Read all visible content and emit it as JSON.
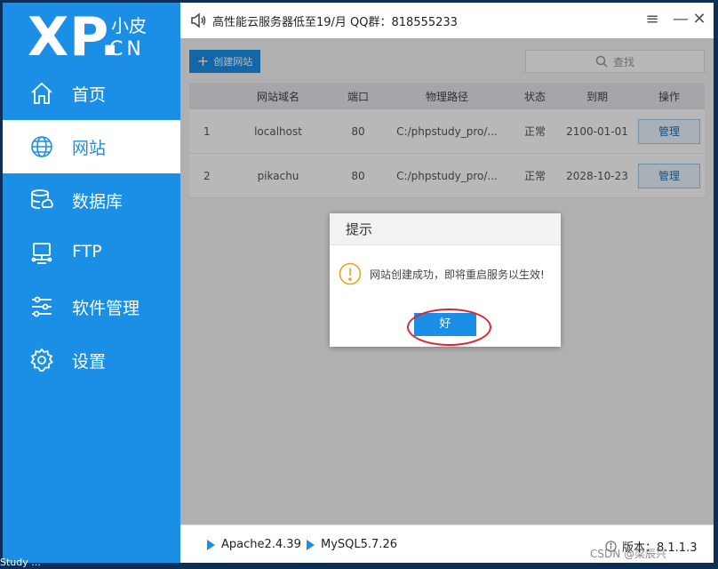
{
  "logo": {
    "main": "XP.",
    "small_top": "小皮",
    "small_bottom": "CN"
  },
  "sidebar": {
    "items": [
      {
        "label": "首页",
        "icon": "home-icon"
      },
      {
        "label": "网站",
        "icon": "globe-icon",
        "active": true
      },
      {
        "label": "数据库",
        "icon": "database-icon"
      },
      {
        "label": "FTP",
        "icon": "ftp-icon"
      },
      {
        "label": "软件管理",
        "icon": "sliders-icon"
      },
      {
        "label": "设置",
        "icon": "gear-icon"
      }
    ]
  },
  "topbar": {
    "notice": "高性能云服务器低至19/月   QQ群：818555233",
    "menu_label": "≡",
    "close_label": "✕"
  },
  "toolbar": {
    "create_label": "创建网站",
    "search_placeholder": "查找"
  },
  "table": {
    "headers": [
      "",
      "网站域名",
      "端口",
      "物理路径",
      "状态",
      "到期",
      "操作"
    ],
    "rows": [
      {
        "index": "1",
        "domain": "localhost",
        "port": "80",
        "path": "C:/phpstudy_pro/...",
        "status": "正常",
        "expire": "2100-01-01",
        "action": "管理"
      },
      {
        "index": "2",
        "domain": "pikachu",
        "port": "80",
        "path": "C:/phpstudy_pro/...",
        "status": "正常",
        "expire": "2028-10-23",
        "action": "管理"
      }
    ]
  },
  "footer": {
    "apache": "Apache2.4.39",
    "mysql": "MySQL5.7.26",
    "version": "版本：8.1.1.3"
  },
  "dialog": {
    "title": "提示",
    "message": "网站创建成功，即将重启服务以生效!",
    "ok_label": "好"
  },
  "desktop": {
    "text": "Study ..."
  },
  "watermark": "CSDN @梁辰兴",
  "colors": {
    "accent": "#1b8fe6",
    "warning": "#f0a020",
    "highlight_ring": "#e0262d"
  }
}
